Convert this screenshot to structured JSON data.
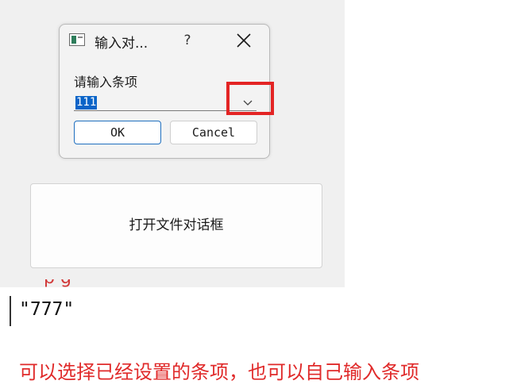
{
  "dialog": {
    "title": "输入对...",
    "help_symbol": "?",
    "prompt": "请输入条项",
    "combo_value": "111",
    "ok_label": "OK",
    "cancel_label": "Cancel"
  },
  "main": {
    "open_file_button_label": "打开文件对话框"
  },
  "debug": {
    "output": "\"777\""
  },
  "annotation": {
    "text": "可以选择已经设置的条项，也可以自己输入条项"
  },
  "colors": {
    "highlight": "#e32424",
    "annotation": "#e02a2a",
    "selection": "#0a64c8",
    "default_button_border": "#1f6fbf"
  },
  "icons": {
    "app": "app-window-icon",
    "help": "help-icon",
    "close": "close-icon",
    "dropdown": "chevron-down-icon"
  }
}
